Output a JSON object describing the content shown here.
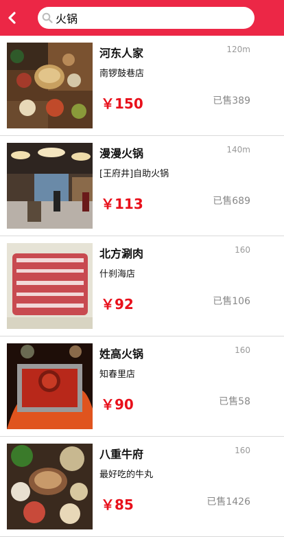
{
  "search": {
    "value": "火锅"
  },
  "items": [
    {
      "name": "河东人家",
      "distance": "120m",
      "branch": "南锣鼓巷店",
      "price": "￥150",
      "sold": "已售389"
    },
    {
      "name": "漫漫火锅",
      "distance": "140m",
      "branch": "[王府井]自助火锅",
      "price": "￥113",
      "sold": "已售689"
    },
    {
      "name": "北方涮肉",
      "distance": "160",
      "branch": "什刹海店",
      "price": "￥92",
      "sold": "已售106"
    },
    {
      "name": "姓高火锅",
      "distance": "160",
      "branch": "知春里店",
      "price": "￥90",
      "sold": "已售58"
    },
    {
      "name": "八重牛府",
      "distance": "160",
      "branch": "最好吃的牛丸",
      "price": "￥85",
      "sold": "已售1426"
    }
  ],
  "colors": {
    "header": "#ec2746",
    "price": "#e8101b"
  }
}
